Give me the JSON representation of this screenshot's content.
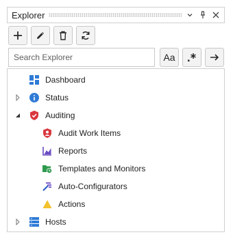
{
  "panel": {
    "title": "Explorer"
  },
  "search": {
    "placeholder": "Search Explorer"
  },
  "options": {
    "match_case_label": "Aa"
  },
  "tree": {
    "dashboard": "Dashboard",
    "status": "Status",
    "auditing": "Auditing",
    "audit_work_items": "Audit Work Items",
    "reports": "Reports",
    "templates": "Templates and Monitors",
    "auto_configurators": "Auto-Configurators",
    "actions": "Actions",
    "hosts": "Hosts"
  },
  "icons": {
    "dashboard": "dashboard-icon",
    "status": "info-icon",
    "auditing": "shield-check-icon",
    "audit_work_items": "shield-user-icon",
    "reports": "chart-icon",
    "templates": "folder-clock-icon",
    "auto_configurators": "wand-icon",
    "actions": "warning-icon",
    "hosts": "server-icon"
  },
  "colors": {
    "blue": "#2f7bd6",
    "red": "#d9383f",
    "purple": "#6a4bc3",
    "green": "#2e9a4d",
    "yellow": "#f2c12e"
  }
}
